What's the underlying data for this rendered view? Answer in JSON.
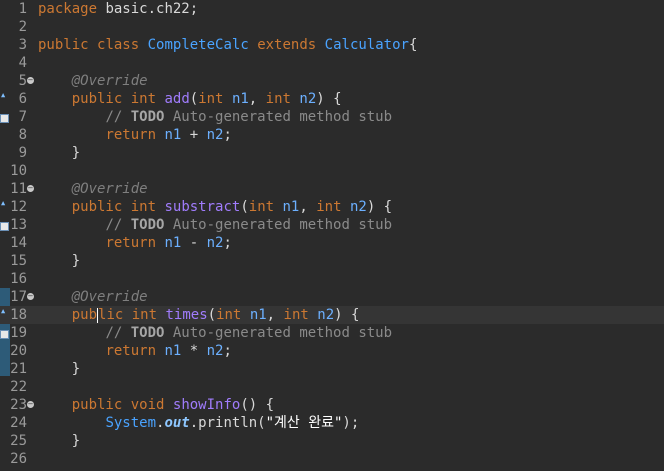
{
  "editor": {
    "line_numbers": [
      "1",
      "2",
      "3",
      "4",
      "5",
      "6",
      "7",
      "8",
      "9",
      "10",
      "11",
      "12",
      "13",
      "14",
      "15",
      "16",
      "17",
      "18",
      "19",
      "20",
      "21",
      "22",
      "23",
      "24",
      "25",
      "26"
    ],
    "l1": {
      "kw": "package",
      "rest": " basic.ch22;"
    },
    "l3": {
      "kw1": "public",
      "kw2": "class",
      "name": "CompleteCalc",
      "kw3": "extends",
      "parent": "Calculator",
      "brace": "{"
    },
    "l5": {
      "ann": "@Override"
    },
    "l6": {
      "kw": "public",
      "type": "int",
      "fn": "add",
      "p1t": "int",
      "p1": "n1",
      "p2t": "int",
      "p2": "n2"
    },
    "l7": {
      "cm": "// ",
      "todo": "TODO",
      "rest": " Auto-generated method stub"
    },
    "l8": {
      "kw": "return",
      "a": "n1",
      "op": " + ",
      "b": "n2",
      "end": ";"
    },
    "l9": {
      "brace": "}"
    },
    "l11": {
      "ann": "@Override"
    },
    "l12": {
      "kw": "public",
      "type": "int",
      "fn": "substract",
      "p1t": "int",
      "p1": "n1",
      "p2t": "int",
      "p2": "n2"
    },
    "l13": {
      "cm": "// ",
      "todo": "TODO",
      "rest": " Auto-generated method stub"
    },
    "l14": {
      "kw": "return",
      "a": "n1",
      "op": " - ",
      "b": "n2",
      "end": ";"
    },
    "l15": {
      "brace": "}"
    },
    "l17": {
      "ann": "@Override"
    },
    "l18": {
      "kw_a": "pub",
      "kw_b": "lic",
      "type": "int",
      "fn": "times",
      "p1t": "int",
      "p1": "n1",
      "p2t": "int",
      "p2": "n2"
    },
    "l19": {
      "cm": "// ",
      "todo": "TODO",
      "rest": " Auto-generated method stub"
    },
    "l20": {
      "kw": "return",
      "a": "n1",
      "op": " * ",
      "b": "n2",
      "end": ";"
    },
    "l21": {
      "brace": "}"
    },
    "l23": {
      "kw": "public",
      "type": "void",
      "fn": "showInfo",
      "rest": "() {"
    },
    "l24": {
      "cls": "System",
      "dot1": ".",
      "field": "out",
      "call": ".println(",
      "str": "\"계산 완료\"",
      "end": ");"
    },
    "l25": {
      "brace": "}"
    }
  },
  "icons": {
    "fold": "collapse-icon",
    "override": "override-marker-icon",
    "task": "task-marker-icon"
  },
  "colors": {
    "background": "#2b2b2b",
    "keyword": "#cc7832",
    "class": "#4aa3ff",
    "method": "#a07cfc",
    "annotation": "#7f7f7f",
    "comment": "#8a8a8a",
    "gutter_highlight": "#2d5b78"
  }
}
